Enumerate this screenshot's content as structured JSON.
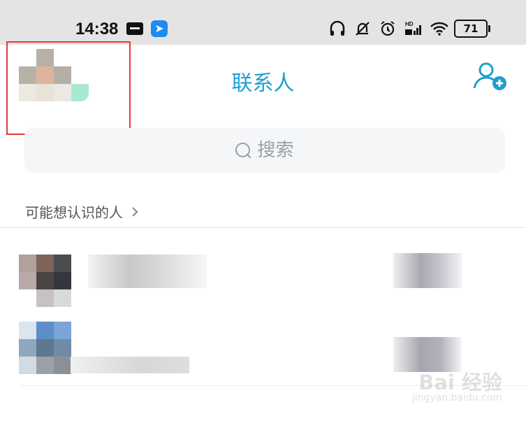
{
  "status_bar": {
    "time": "14:38",
    "battery": "71",
    "icons": [
      "message-icon",
      "app-icon",
      "headphones-icon",
      "silent-bell-icon",
      "alarm-icon",
      "hd-signal-icon",
      "wifi-icon",
      "battery-icon"
    ]
  },
  "header": {
    "title": "联系人",
    "add_contact_icon": "add-user-icon"
  },
  "search": {
    "placeholder": "搜索",
    "icon": "search-icon"
  },
  "section": {
    "label": "可能想认识的人",
    "chevron": "chevron-right-icon"
  },
  "suggestions": [
    {
      "avatar": "avatar-1",
      "name": "",
      "subtitle": "",
      "action": ""
    },
    {
      "avatar": "avatar-2",
      "name": "",
      "subtitle": "",
      "action": ""
    }
  ],
  "colors": {
    "accent": "#1e9fd0",
    "highlight_border": "#e03b3b"
  },
  "watermark": {
    "brand": "Bai 经验",
    "url": "jingyan.baidu.com"
  }
}
